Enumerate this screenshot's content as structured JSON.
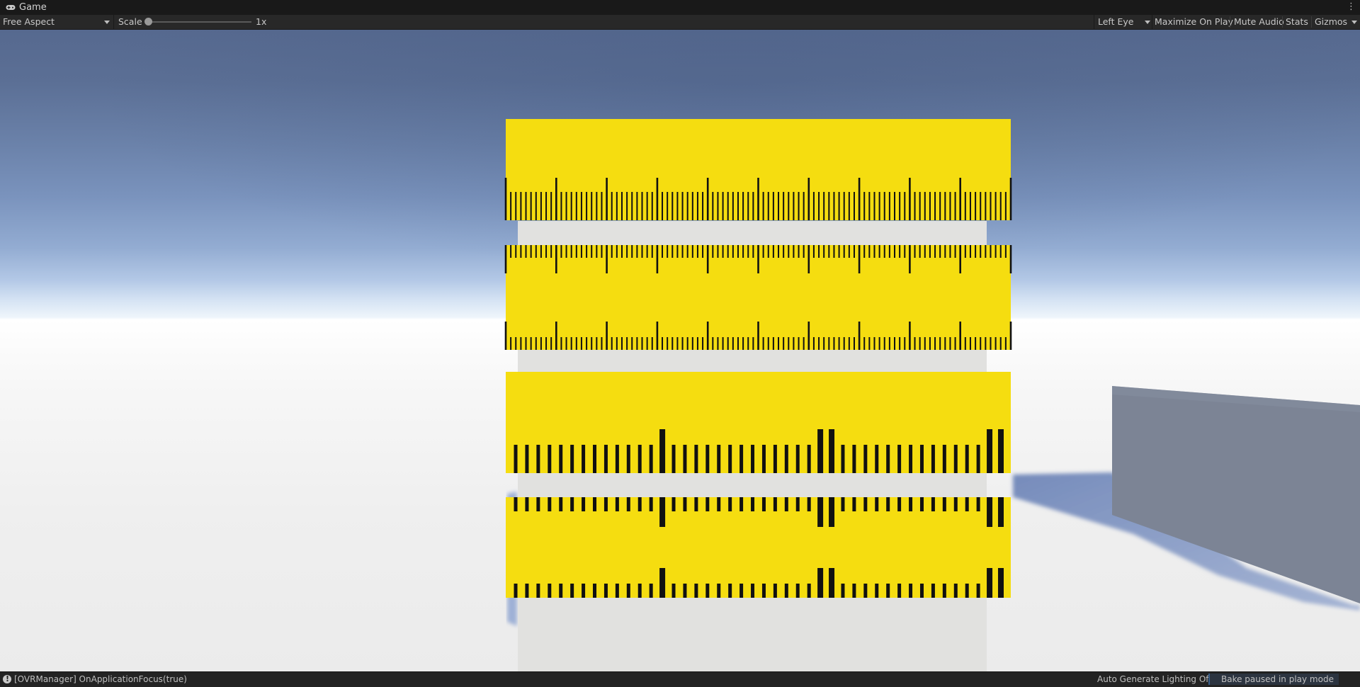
{
  "window": {
    "tab_title": "Game",
    "tab_icon": "gamepad-icon",
    "menu_icon": "kebab-menu-icon"
  },
  "toolbar": {
    "aspect": "Free Aspect",
    "scale_label": "Scale",
    "scale_value": "1x",
    "eye": "Left Eye",
    "maximize_on_play": "Maximize On Play",
    "mute_audio": "Mute Audio",
    "stats": "Stats",
    "gizmos": "Gizmos"
  },
  "scene": {
    "colors": {
      "ruler_yellow": "#f5dd10",
      "tick": "#111111",
      "panel": "#e1e1df",
      "cube": "#7c8495"
    }
  },
  "status": {
    "message": "[OVRManager] OnApplicationFocus(true)",
    "lighting": "Auto Generate Lighting Off",
    "bake": "Bake paused in play mode"
  }
}
